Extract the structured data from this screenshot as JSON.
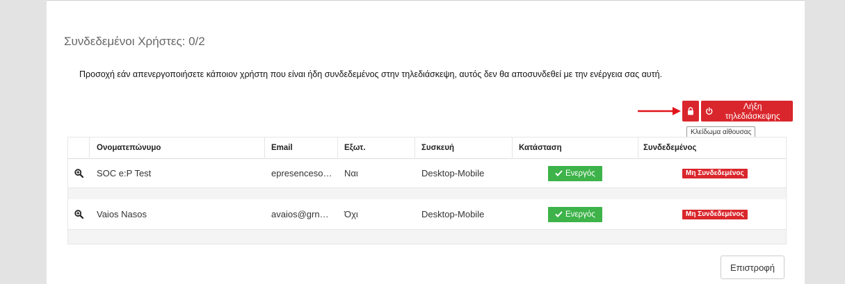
{
  "page": {
    "title": "Συνδεδεμένοι Χρήστες: 0/2",
    "warning": "Προσοχή εάν απενεργοποιήσετε κάποιον χρήστη που είναι ήδη συνδεδεμένος στην τηλεδιάσκεψη, αυτός δεν θα αποσυνδεθεί με την ενέργεια σας αυτή."
  },
  "toolbar": {
    "lock_icon": "lock-icon",
    "end_label": "Λήξη τηλεδιάσκεψης",
    "end_icon": "power-icon",
    "tooltip": "Κλείδωμα αίθουσας",
    "accent_color": "#d9262c"
  },
  "table": {
    "headers": [
      "Ονοματεπώνυμο",
      "Email",
      "Εξωτ.",
      "Συσκευή",
      "Κατάσταση",
      "Συνδεδεμένος"
    ],
    "rows": [
      {
        "name": "SOC e:P Test",
        "email": "epresenceso…",
        "external": "Ναι",
        "device": "Desktop-Mobile",
        "status": "Ενεργός",
        "connected": "Μη Συνδεδεμένος"
      },
      {
        "name": "Vaios Nasos",
        "email": "avaios@grn…",
        "external": "Όχι",
        "device": "Desktop-Mobile",
        "status": "Ενεργός",
        "connected": "Μη Συνδεδεμένος"
      }
    ],
    "status_color": "#3db34a",
    "connected_color": "#d9262c"
  },
  "footer": {
    "back_label": "Επιστροφή"
  }
}
